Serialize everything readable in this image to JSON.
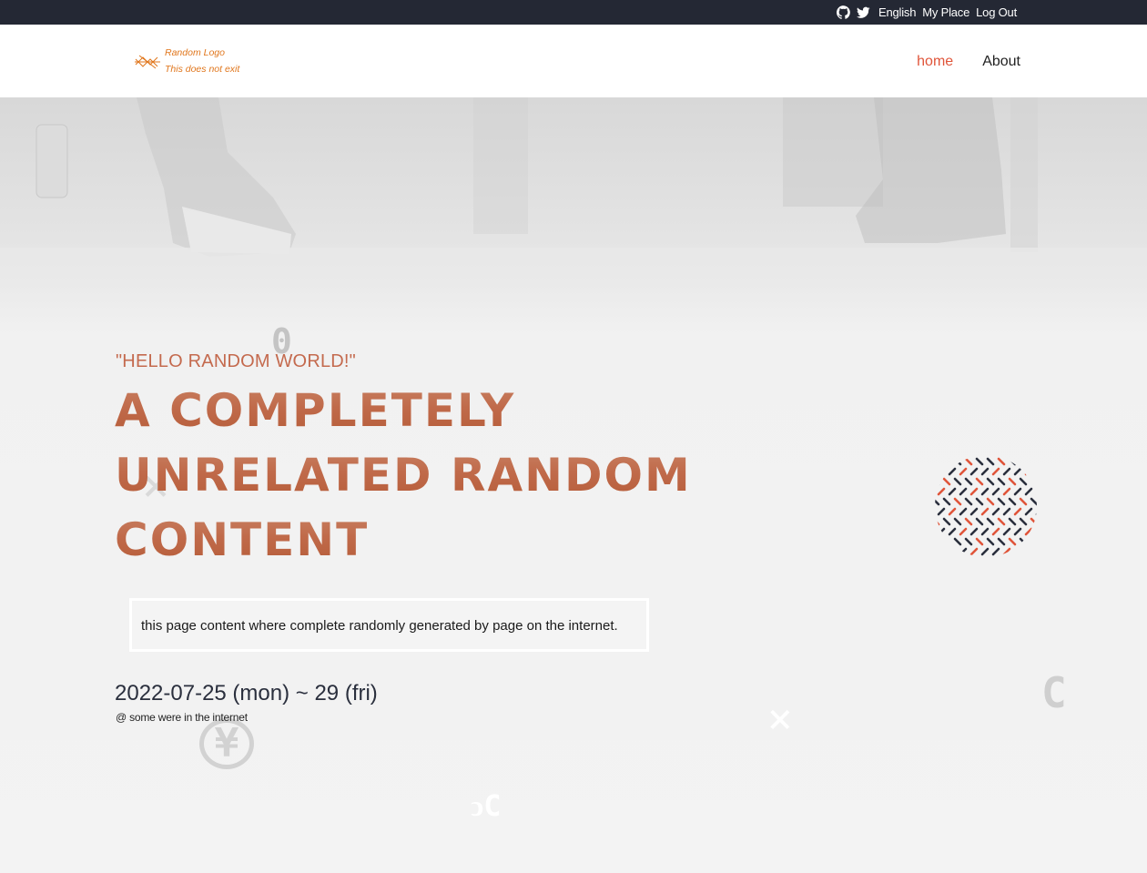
{
  "topbar": {
    "icons": [
      "github-icon",
      "twitter-icon"
    ],
    "links": [
      "English",
      "My Place",
      "Log Out"
    ]
  },
  "header": {
    "logo": {
      "line1": "Random Logo",
      "line2": "This does not exit"
    },
    "nav": [
      {
        "label": "home",
        "active": true
      },
      {
        "label": "About",
        "active": false
      }
    ]
  },
  "hero": {
    "quote": "\"HELLO RANDOM WORLD!\"",
    "headline": [
      "A COMPLETELY",
      "UNRELATED RANDOM",
      "CONTENT"
    ],
    "description": "this page content where complete randomly generated by page on the internet.",
    "date": "2022-07-25 (mon) ~ 29 (fri)",
    "place": "@ some were in the internet"
  },
  "decorations": {
    "glyphs": [
      "0",
      "×",
      "¥",
      "×",
      "C",
      "ↄC"
    ]
  },
  "colors": {
    "accent": "#e0553a",
    "headline": "#c47a5e",
    "topbar": "#242834",
    "logo": "#e0761c"
  }
}
